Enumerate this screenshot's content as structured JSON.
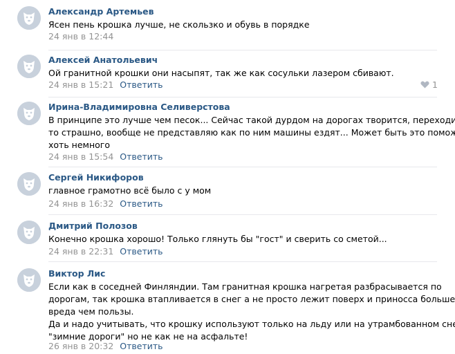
{
  "comments": [
    {
      "author": "Александр Артемьев",
      "text": [
        "Ясен пень крошка лучше, не скользко и обувь в порядке"
      ],
      "date": "24 янв в 12:44",
      "reply": "",
      "likes": ""
    },
    {
      "author": "Алексей Анатольевич",
      "text": [
        "Ой гранитной крошки они насыпят, так же как сосульки лазером сбивают."
      ],
      "date": "24 янв в 15:21",
      "reply": "Ответить",
      "likes": "1"
    },
    {
      "author": "Ирина-Владимировна Селиверстова",
      "text": [
        "В принципе это лучше чем песок... Сейчас такой дурдом на дорогах творится, переходить",
        "то страшно, вообще не представляю как по ним машины ездят... Может быть это поможет",
        "хоть немного"
      ],
      "date": "24 янв в 15:54",
      "reply": "Ответить",
      "likes": ""
    },
    {
      "author": "Сергей Никифоров",
      "text": [
        "главное грамотно всё было с у мом"
      ],
      "date": "24 янв в 16:32",
      "reply": "Ответить",
      "likes": ""
    },
    {
      "author": "Дмитрий Полозов",
      "text": [
        "Конечно крошка хорошо! Только глянуть бы \"гост\" и сверить со сметой..."
      ],
      "date": "24 янв в 22:31",
      "reply": "Ответить",
      "likes": ""
    },
    {
      "author": "Виктор Лис",
      "text": [
        "Если как в соседней Финляндии. Там гранитная крошка нагретая разбрасывается по",
        "дорогам, так крошка втапливается в снег а не просто лежит поверх и приносса больше",
        "вреда чем пользы.",
        "Да и надо учитывать, что крошку используют только на льду или на утрамбованном снегу",
        "\"зимние дороги\" но не как не на асфальте!"
      ],
      "date": "26 янв в 20:32",
      "reply": "Ответить",
      "likes": ""
    }
  ],
  "icons": {
    "avatar": "default-dog-avatar-icon",
    "like": "heart-icon"
  },
  "colors": {
    "author": "#2a5885",
    "date": "#939393",
    "avatar_bg": "#c8d1dc",
    "divider": "#e7e8ec"
  }
}
